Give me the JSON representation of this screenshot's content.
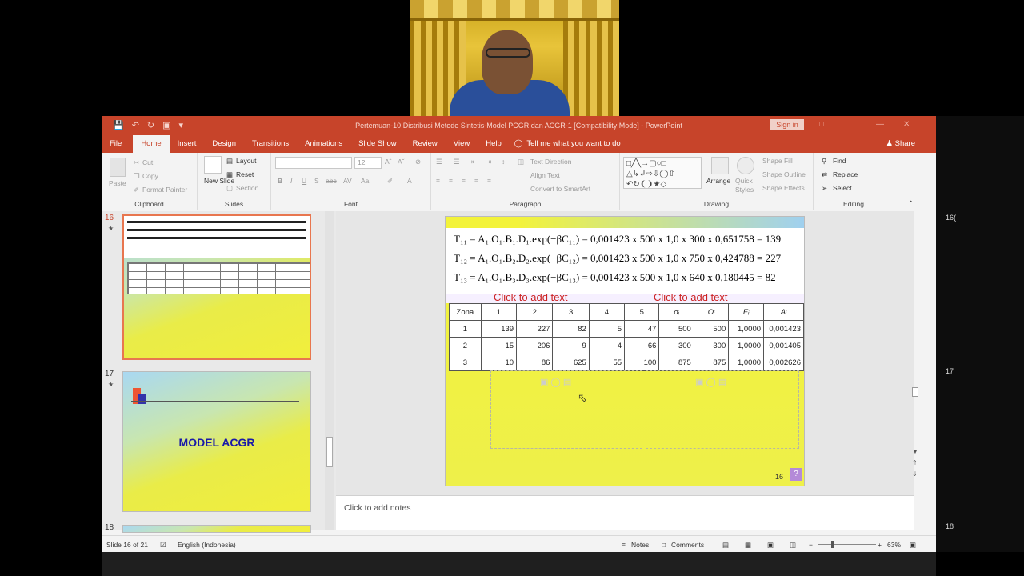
{
  "window": {
    "title": "Pertemuan-10 Distribusi Metode Sintetis-Model PCGR dan ACGR-1 [Compatibility Mode] - PowerPoint",
    "sign_in": "Sign in",
    "share": "Share"
  },
  "tabs": [
    "File",
    "Home",
    "Insert",
    "Design",
    "Transitions",
    "Animations",
    "Slide Show",
    "Review",
    "View",
    "Help"
  ],
  "tell_me": "Tell me what you want to do",
  "ribbon": {
    "clipboard": {
      "label": "Clipboard",
      "paste": "Paste",
      "cut": "Cut",
      "copy": "Copy",
      "format_painter": "Format Painter"
    },
    "slides": {
      "label": "Slides",
      "new_slide": "New Slide",
      "layout": "Layout",
      "reset": "Reset",
      "section": "Section"
    },
    "font": {
      "label": "Font",
      "size": "12"
    },
    "paragraph": {
      "label": "Paragraph",
      "text_direction": "Text Direction",
      "align_text": "Align Text",
      "convert": "Convert to SmartArt"
    },
    "drawing": {
      "label": "Drawing",
      "arrange": "Arrange",
      "quick_styles": "Quick Styles",
      "shape_fill": "Shape Fill",
      "shape_outline": "Shape Outline",
      "shape_effects": "Shape Effects"
    },
    "editing": {
      "label": "Editing",
      "find": "Find",
      "replace": "Replace",
      "select": "Select"
    }
  },
  "thumbnails": {
    "s16": {
      "num": "16"
    },
    "s17": {
      "num": "17",
      "title": "MODEL ACGR"
    },
    "s18": {
      "num": "18"
    }
  },
  "slide": {
    "eq1": "T₁₁ = A₁.O₁.B₁.D₁.exp(−βC₁₁) = 0,001423 x 500 x 1,0 x 300 x 0,651758 = 139",
    "eq2": "T₁₂ = A₁.O₁.B₂.D₂.exp(−βC₁₂) = 0,001423 x 500 x 1,0 x 750 x 0,424788 = 227",
    "eq3": "T₁₃ = A₁.O₁.B₃.D₃.exp(−βC₁₃) = 0,001423 x 500 x 1,0 x 640 x 0,180445 = 82",
    "placeholder_left": "Click to add text",
    "placeholder_right": "Click to add text",
    "table": {
      "header": [
        "Zona",
        "1",
        "2",
        "3",
        "4",
        "5",
        "oᵢ",
        "Oᵢ",
        "Eᵢ",
        "Aᵢ"
      ],
      "rows": [
        [
          "1",
          "139",
          "227",
          "82",
          "5",
          "47",
          "500",
          "500",
          "1,0000",
          "0,001423"
        ],
        [
          "2",
          "15",
          "206",
          "9",
          "4",
          "66",
          "300",
          "300",
          "1,0000",
          "0,001405"
        ],
        [
          "3",
          "10",
          "86",
          "625",
          "55",
          "100",
          "875",
          "875",
          "1,0000",
          "0,002626"
        ]
      ]
    },
    "page_number": "16",
    "help_glyph": "?"
  },
  "notes_placeholder": "Click to add notes",
  "status": {
    "slide_info": "Slide 16 of 21",
    "language": "English (Indonesia)",
    "notes": "Notes",
    "comments": "Comments",
    "zoom": "63%"
  },
  "colors": {
    "accent": "#c7442a",
    "slide_yellow": "#f1ee3c",
    "slide_blue": "#a9d8f2"
  }
}
